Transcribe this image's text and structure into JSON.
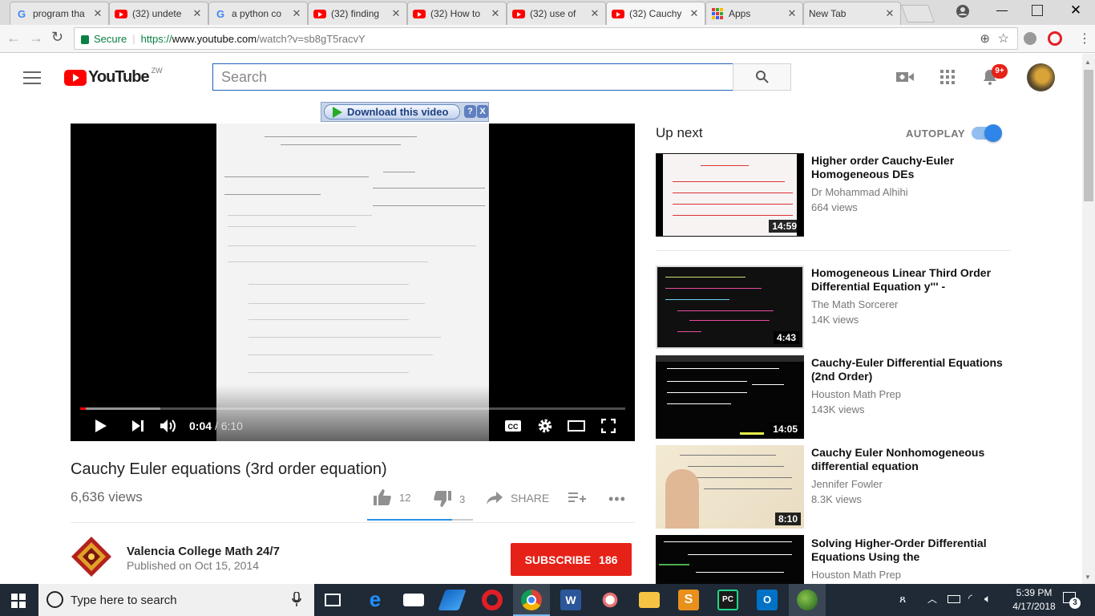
{
  "browser": {
    "tabs": [
      {
        "label": "program tha",
        "icon": "google-icon"
      },
      {
        "label": "(32) undete",
        "icon": "youtube-icon"
      },
      {
        "label": "a python co",
        "icon": "google-icon"
      },
      {
        "label": "(32) finding",
        "icon": "youtube-icon"
      },
      {
        "label": "(32) How to",
        "icon": "youtube-icon"
      },
      {
        "label": "(32) use of",
        "icon": "youtube-icon"
      },
      {
        "label": "(32) Cauchy",
        "icon": "youtube-icon"
      },
      {
        "label": "Apps",
        "icon": "apps-icon"
      },
      {
        "label": "New Tab",
        "icon": ""
      }
    ],
    "secure_label": "Secure",
    "url_scheme": "https://",
    "url_host": "www.youtube.com",
    "url_path": "/watch?v=sb8gT5racvY"
  },
  "youtube": {
    "logo_text": "YouTube",
    "region": "ZW",
    "search_placeholder": "Search",
    "notifications_badge": "9+"
  },
  "download_bar": {
    "label": "Download this video",
    "help": "?",
    "close": "X"
  },
  "video": {
    "current_time": "0:04",
    "separator": " / ",
    "duration": "6:10",
    "progress_fraction": 0.011,
    "title": "Cauchy Euler equations (3rd order equation)",
    "views": "6,636 views",
    "likes": "12",
    "dislikes": "3",
    "share_label": "SHARE"
  },
  "channel": {
    "name": "Valencia College Math 24/7",
    "published": "Published on Oct 15, 2014",
    "subscribe_label": "SUBSCRIBE",
    "subscriber_count": "186"
  },
  "sidebar": {
    "up_next": "Up next",
    "autoplay_label": "AUTOPLAY",
    "autoplay_on": true,
    "items": [
      {
        "title": "Higher order Cauchy-Euler Homogeneous DEs",
        "channel": "Dr Mohammad Alhihi",
        "views": "664 views",
        "duration": "14:59"
      },
      {
        "title": "Homogeneous Linear Third Order Differential Equation y''' -",
        "channel": "The Math Sorcerer",
        "views": "14K views",
        "duration": "4:43"
      },
      {
        "title": "Cauchy-Euler Differential Equations (2nd Order)",
        "channel": "Houston Math Prep",
        "views": "143K views",
        "duration": "14:05"
      },
      {
        "title": "Cauchy Euler Nonhomogeneous differential equation",
        "channel": "Jennifer Fowler",
        "views": "8.3K views",
        "duration": "8:10"
      },
      {
        "title": "Solving Higher-Order Differential Equations Using the",
        "channel": "Houston Math Prep",
        "views": "",
        "duration": ""
      }
    ]
  },
  "taskbar": {
    "search_placeholder": "Type here to search",
    "time": "5:39 PM",
    "date": "4/17/2018",
    "notification_count": "3"
  }
}
